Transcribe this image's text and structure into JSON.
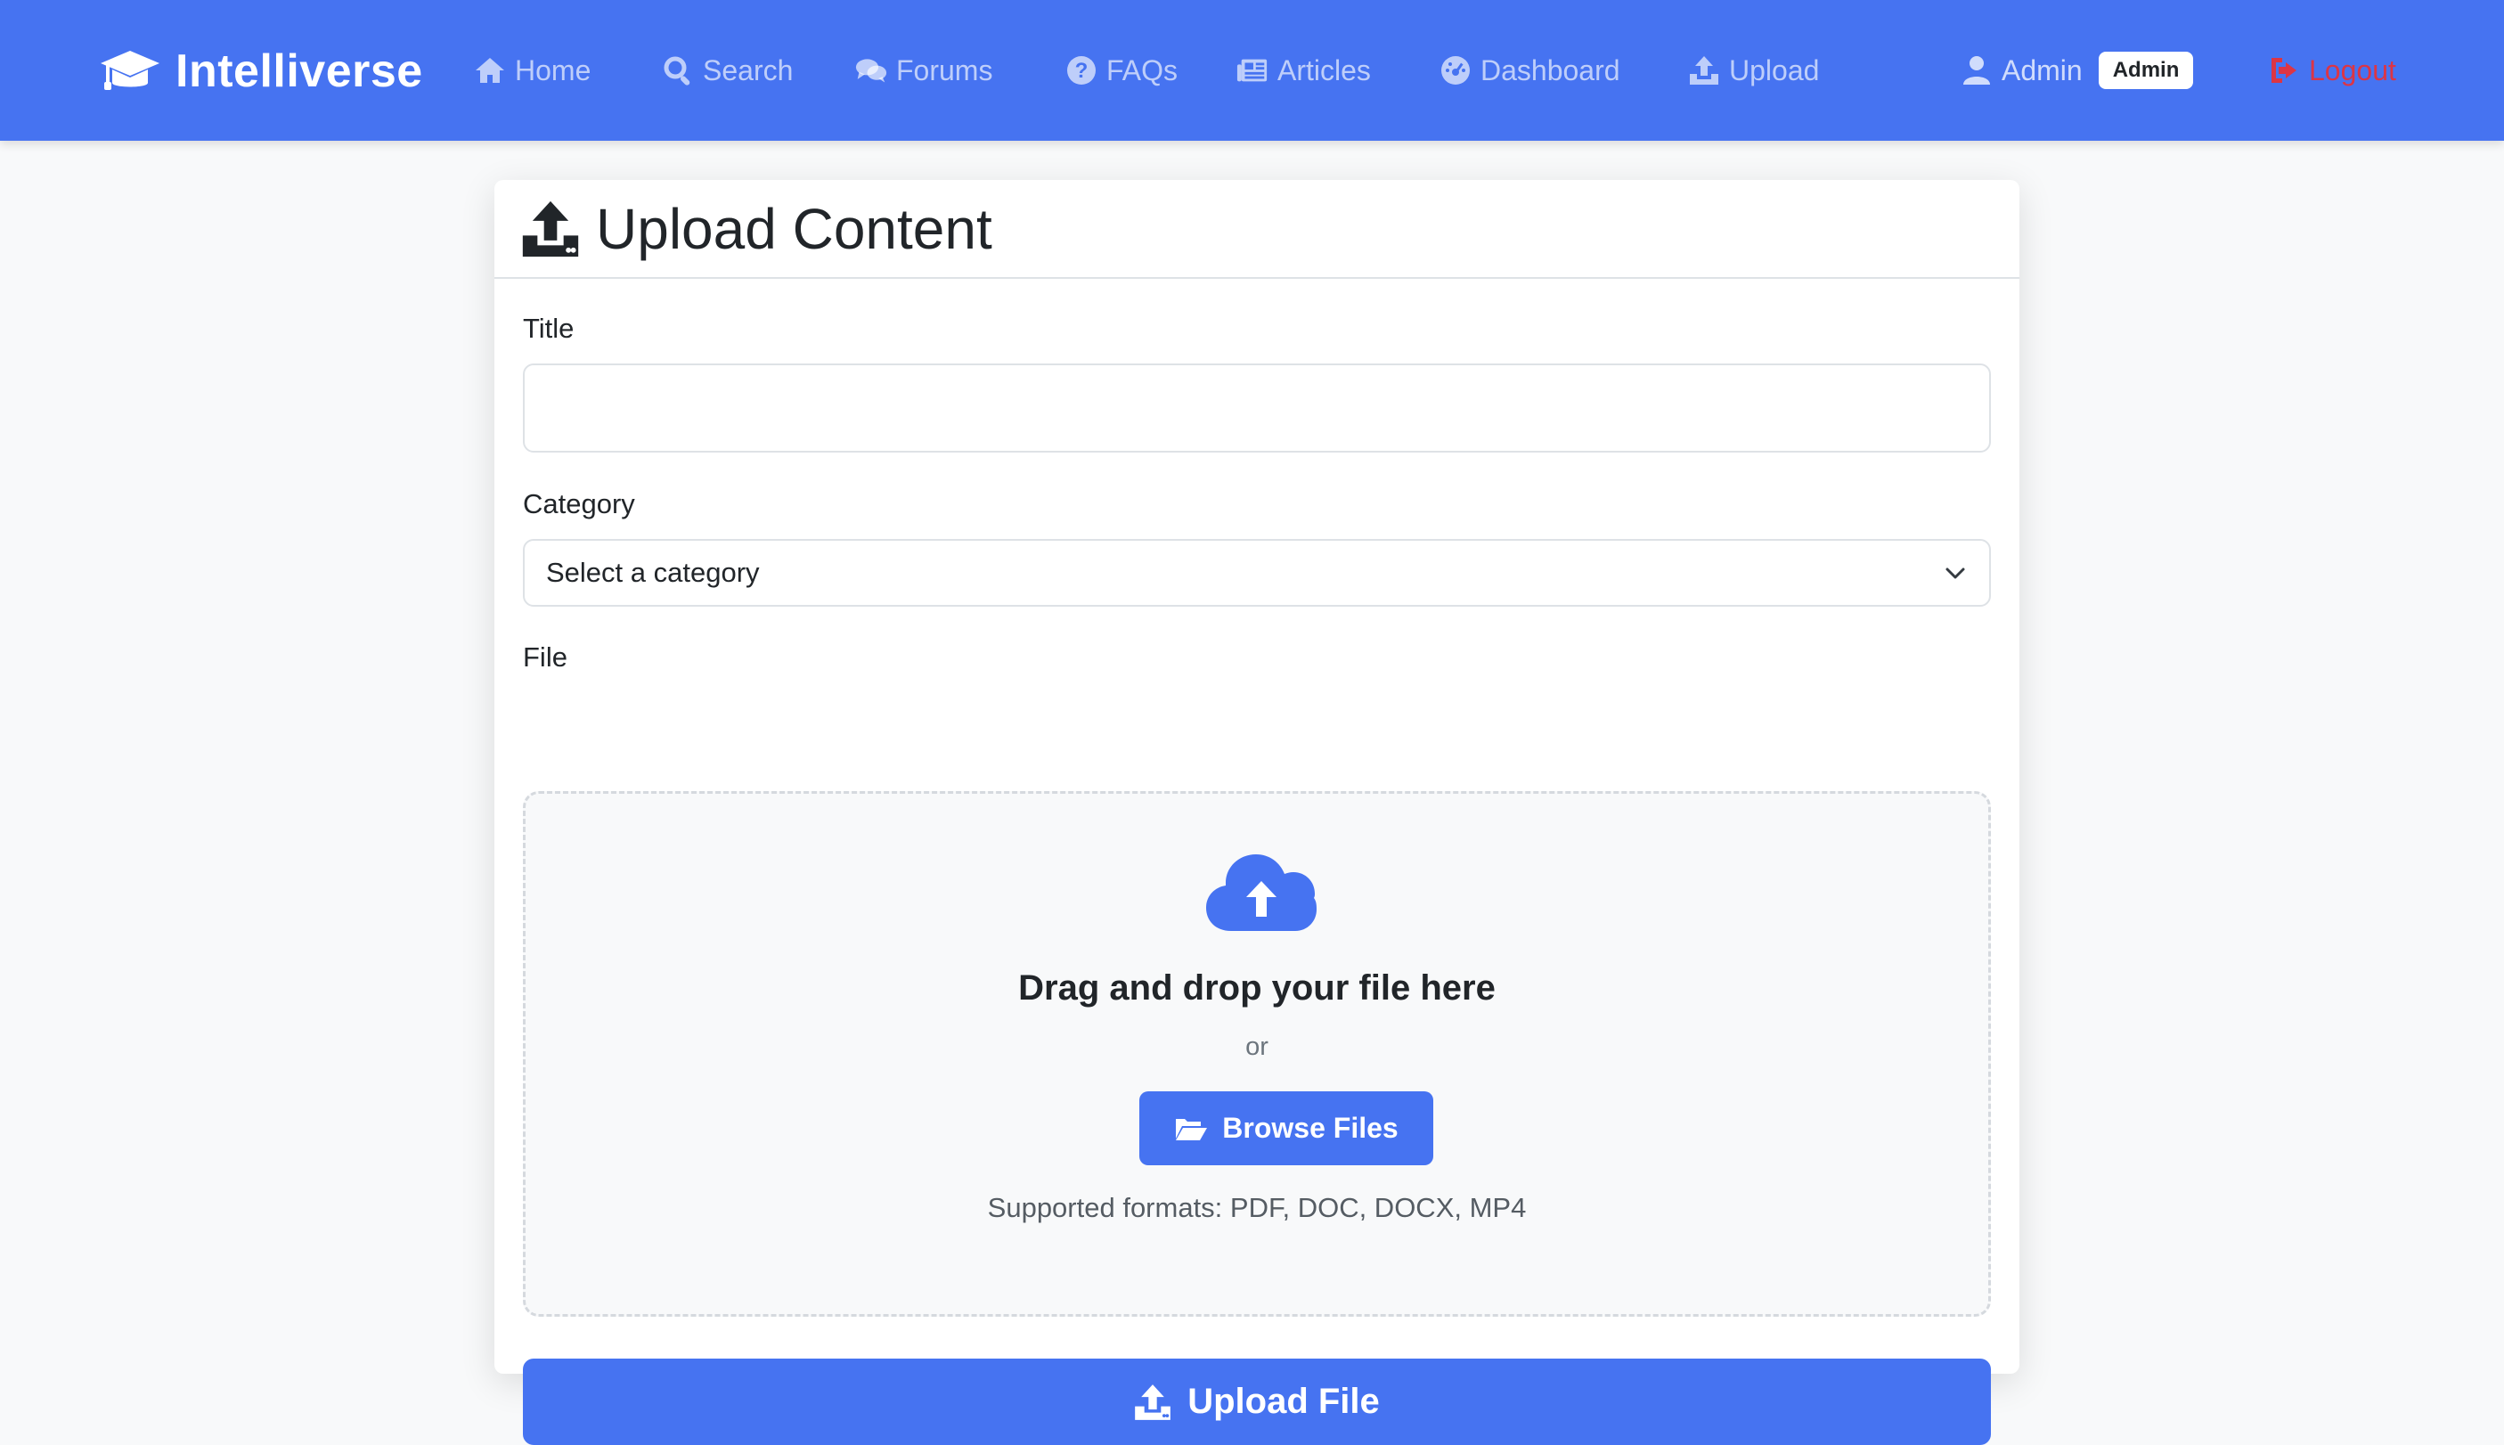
{
  "brand": {
    "name": "Intelliverse"
  },
  "nav": {
    "items": [
      {
        "label": "Home",
        "icon": "home-icon"
      },
      {
        "label": "Search",
        "icon": "search-icon"
      },
      {
        "label": "Forums",
        "icon": "comments-icon"
      },
      {
        "label": "FAQs",
        "icon": "question-circle-icon"
      },
      {
        "label": "Articles",
        "icon": "newspaper-icon"
      },
      {
        "label": "Dashboard",
        "icon": "gauge-icon"
      },
      {
        "label": "Upload",
        "icon": "upload-icon"
      }
    ],
    "user": {
      "name": "Admin",
      "role_badge": "Admin",
      "icon": "user-icon"
    },
    "logout": {
      "label": "Logout",
      "icon": "sign-out-icon"
    }
  },
  "colors": {
    "primary": "#4673f1",
    "danger": "#dc3545",
    "page_background": "#f8f9fa"
  },
  "page": {
    "title": "Upload Content",
    "title_icon": "upload-icon"
  },
  "form": {
    "title_label": "Title",
    "title_value": "",
    "category_label": "Category",
    "category_selected": "Select a category",
    "file_label": "File"
  },
  "dropzone": {
    "icon": "cloud-upload-icon",
    "heading": "Drag and drop your file here",
    "or_text": "or",
    "browse_label": "Browse Files",
    "browse_icon": "folder-open-icon",
    "formats_text": "Supported formats: PDF, DOC, DOCX, MP4"
  },
  "submit": {
    "label": "Upload File",
    "icon": "upload-icon"
  }
}
